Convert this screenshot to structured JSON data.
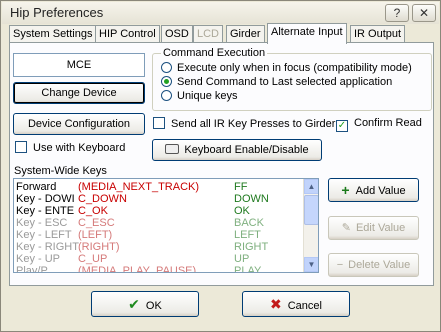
{
  "window": {
    "title": "Hip Preferences",
    "help_glyph": "?",
    "close_glyph": "✕"
  },
  "tabs": [
    {
      "label": "System Settings"
    },
    {
      "label": "HIP Control"
    },
    {
      "label": "OSD"
    },
    {
      "label": "LCD",
      "disabled": true
    },
    {
      "label": "Girder"
    },
    {
      "label": "Alternate Input",
      "active": true
    },
    {
      "label": "IR Output"
    }
  ],
  "left": {
    "device_name": "MCE",
    "change_device": "Change Device",
    "use_with_keyboard": "Use with Keyboard",
    "device_configuration": "Device Configuration"
  },
  "command_execution": {
    "title": "Command Execution",
    "options": [
      {
        "label": "Execute only when in focus (compatibility mode)",
        "selected": false
      },
      {
        "label": "Send Command to Last selected application",
        "selected": true
      },
      {
        "label": "Unique keys",
        "selected": false
      }
    ]
  },
  "options": {
    "send_all_ir": {
      "label": "Send all IR Key Presses to Girder",
      "checked": false
    },
    "confirm_read": {
      "label": "Confirm Read",
      "checked": true
    }
  },
  "keyboard_button": "Keyboard Enable/Disable",
  "system_keys": {
    "label": "System-Wide Keys",
    "rows": [
      {
        "key": "Forward",
        "action": "(MEDIA_NEXT_TRACK)",
        "code": "FF",
        "dim": false
      },
      {
        "key": "Key - DOWI",
        "action": "C_DOWN",
        "code": "DOWN",
        "dim": false
      },
      {
        "key": "Key - ENTE",
        "action": "C_OK",
        "code": "OK",
        "dim": false
      },
      {
        "key": "Key - ESC",
        "action": "C_ESC",
        "code": "BACK",
        "dim": true
      },
      {
        "key": "Key - LEFT",
        "action": "(LEFT)",
        "code": "LEFT",
        "dim": true
      },
      {
        "key": "Key - RIGHT",
        "action": "(RIGHT)",
        "code": "RIGHT",
        "dim": true
      },
      {
        "key": "Key - UP",
        "action": "C_UP",
        "code": "UP",
        "dim": true
      },
      {
        "key": "Play/P...",
        "action": "(MEDIA_PLAY_PAUSE)",
        "code": "PLAY",
        "dim": true
      }
    ]
  },
  "side_buttons": {
    "add": "Add Value",
    "edit": "Edit Value",
    "delete": "Delete Value"
  },
  "footer": {
    "ok": "OK",
    "cancel": "Cancel"
  },
  "colors": {
    "action_red": "#c80000",
    "code_green": "#1f7a1f",
    "dim_gray": "#9a9a9a"
  }
}
